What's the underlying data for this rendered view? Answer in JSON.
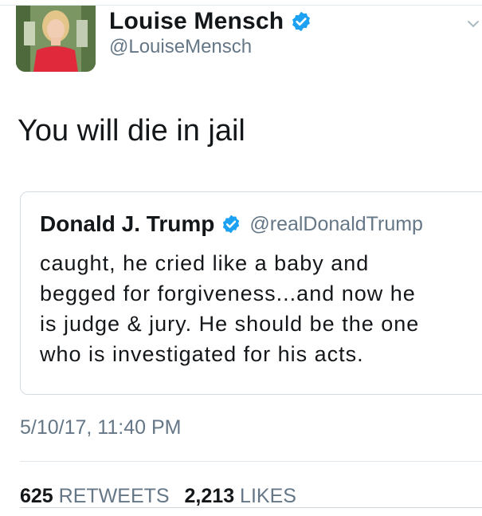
{
  "author": {
    "name": "Louise Mensch",
    "handle": "@LouiseMensch",
    "verified_icon": "verified-badge-icon",
    "avatar_icon": "profile-photo"
  },
  "menu_icon": "chevron-down-icon",
  "tweet": {
    "text": "You will die in jail"
  },
  "quoted_tweet": {
    "name": "Donald J. Trump",
    "handle": "@realDonaldTrump",
    "verified_icon": "verified-badge-icon",
    "text": "caught, he cried like a baby and\nbegged for forgiveness...and now he\nis judge & jury. He should be the one\nwho is investigated for his acts."
  },
  "timestamp": "5/10/17, 11:40 PM",
  "stats": {
    "retweets_count": "625",
    "retweets_label": "RETWEETS",
    "likes_count": "2,213",
    "likes_label": "LIKES"
  },
  "colors": {
    "verified_blue": "#1da1f2",
    "secondary_text": "#657786",
    "border": "#e1e8ed"
  }
}
